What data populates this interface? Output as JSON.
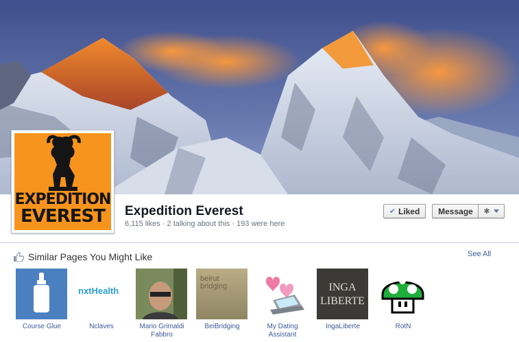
{
  "page": {
    "name": "Expedition Everest",
    "stats": "6,115 likes · 2 talking about this · 193 were here",
    "profile_logo": [
      "EXPEDITION",
      "EVEREST"
    ]
  },
  "actions": {
    "liked_label": "Liked",
    "liked_icon": "check-icon",
    "message_label": "Message",
    "settings_icon": "gear-icon"
  },
  "similar": {
    "title": "Similar Pages You Might Like",
    "see_all": "See All",
    "pages": [
      {
        "name": "Course Glue",
        "thumb_text": ""
      },
      {
        "name": "Nclaves",
        "thumb_text": "nxtHealth"
      },
      {
        "name": "Mario Grimaldi Fabbro",
        "thumb_text": ""
      },
      {
        "name": "BeiBridging",
        "thumb_text": "beirut bridging"
      },
      {
        "name": "My Dating Assistant",
        "thumb_text": ""
      },
      {
        "name": "IngaLiberte",
        "thumb_text": "INGA LIBERTE"
      },
      {
        "name": "RotN",
        "thumb_text": ""
      }
    ]
  },
  "colors": {
    "link": "#3b5998",
    "logo_orange": "#f7941d",
    "sky": "#4a5f96",
    "sunlit_peak": "#e8732a"
  }
}
